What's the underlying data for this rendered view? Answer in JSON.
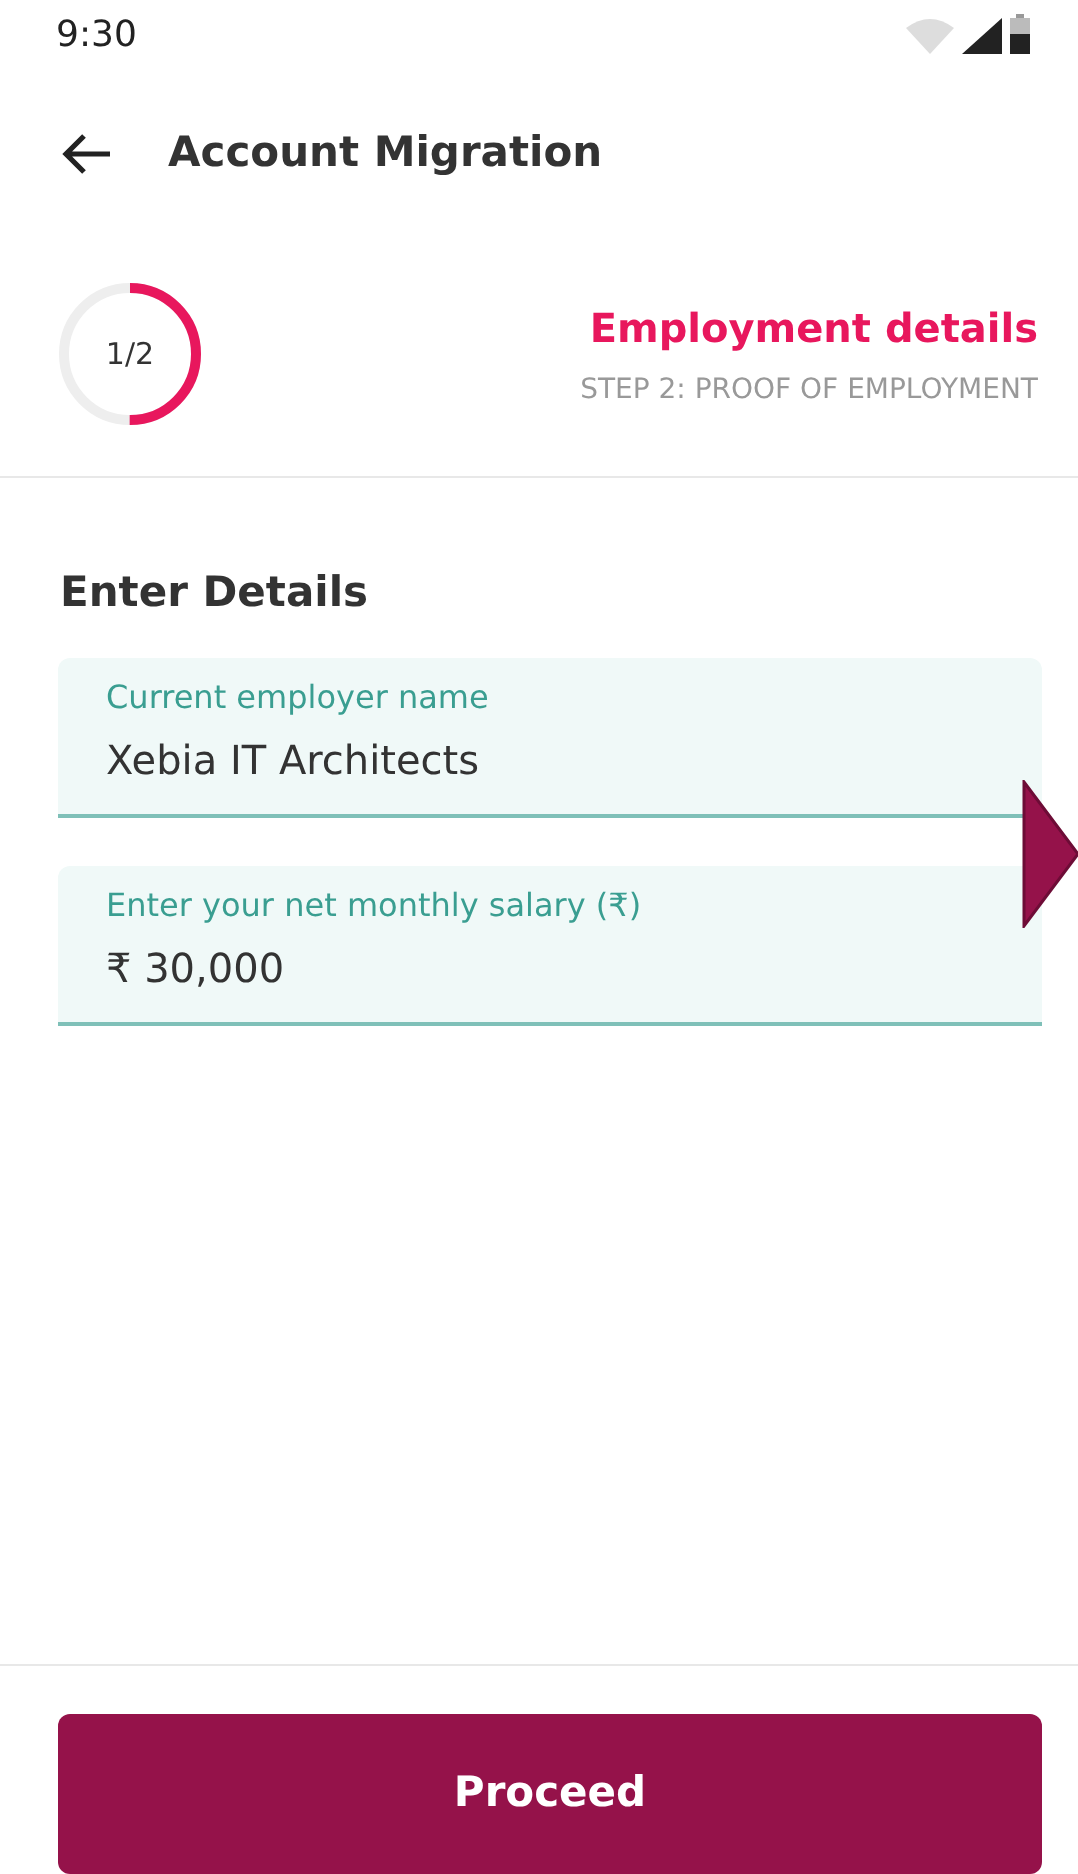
{
  "status_bar": {
    "time": "9:30"
  },
  "header": {
    "title": "Account Migration"
  },
  "stepper": {
    "counter": "1/2",
    "level": 0.5,
    "title": "Employment details",
    "subtitle": "STEP 2: PROOF OF EMPLOYMENT"
  },
  "section_title": "Enter Details",
  "fields": [
    {
      "label": "Current employer name",
      "value": "Xebia IT Architects"
    },
    {
      "label": "Enter your net monthly salary (₹)",
      "value": "₹ 30,000"
    }
  ],
  "buttons": [
    "Proceed"
  ]
}
